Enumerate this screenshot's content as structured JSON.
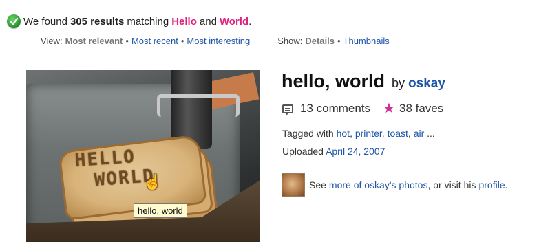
{
  "results": {
    "prefix": "We found",
    "count": "305 results",
    "middle": "matching",
    "term1": "Hello",
    "and": "and",
    "term2": "World",
    "period": "."
  },
  "view": {
    "label": "View:",
    "current": "Most relevant",
    "links": [
      "Most recent",
      "Most interesting"
    ]
  },
  "show": {
    "label": "Show:",
    "current": "Details",
    "links": [
      "Thumbnails"
    ]
  },
  "separator": "•",
  "photo": {
    "tooltip": "hello, world",
    "printed_text_line1": "HELLO",
    "printed_text_line2": "WORLD",
    "title": "hello, world",
    "by": "by",
    "owner": "oskay",
    "comments": "13 comments",
    "faves": "38 faves",
    "tagged_prefix": "Tagged with",
    "tags": [
      "hot",
      "printer",
      "toast",
      "air"
    ],
    "tags_more": "...",
    "uploaded_prefix": "Uploaded",
    "uploaded_date": "April 24, 2007",
    "see_prefix": "See",
    "see_link": "more of oskay's photos",
    "visit_text": ", or visit his",
    "profile_link": "profile",
    "end_period": "."
  },
  "colors": {
    "link": "#1f55a8",
    "highlight": "#e0207f",
    "fave_star": "#d12e9b"
  }
}
